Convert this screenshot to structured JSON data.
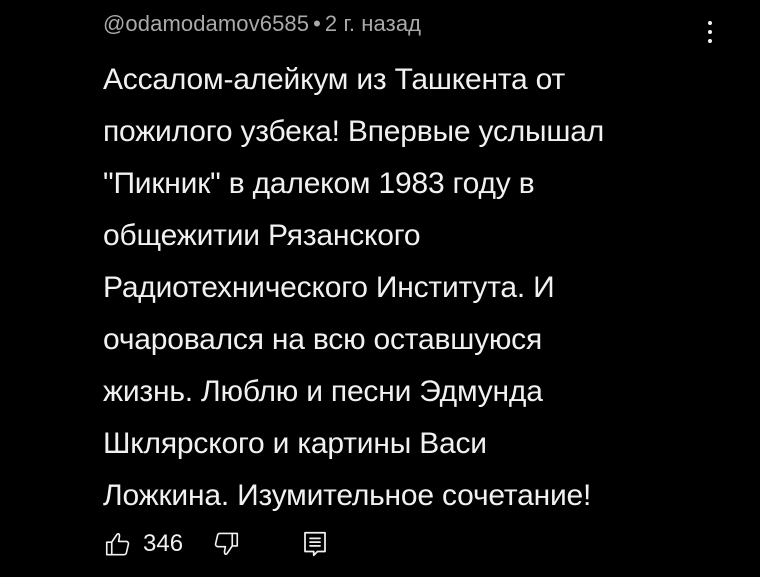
{
  "comment": {
    "author": "@odamodamov6585",
    "separator": "•",
    "time": "2 г. назад",
    "text_lines": [
      "Ассалом-алейкум из Ташкента от",
      "пожилого узбека! Впервые услышал",
      "\"Пикник\" в далеком 1983 году в",
      "общежитии Рязанского",
      "Радиотехнического Института. И",
      "очаровался на всю оставшуюся",
      "жизнь. Люблю и песни Эдмунда",
      "Шклярского и картины Васи",
      "Ложкина. Изумительное сочетание!"
    ],
    "like_count": "346"
  },
  "icons": {
    "more": "more-vertical-icon",
    "like": "thumbs-up-icon",
    "dislike": "thumbs-down-icon",
    "reply": "reply-icon"
  },
  "colors": {
    "background": "#000000",
    "text": "#f1f1f1",
    "meta": "#aaaaaa"
  }
}
